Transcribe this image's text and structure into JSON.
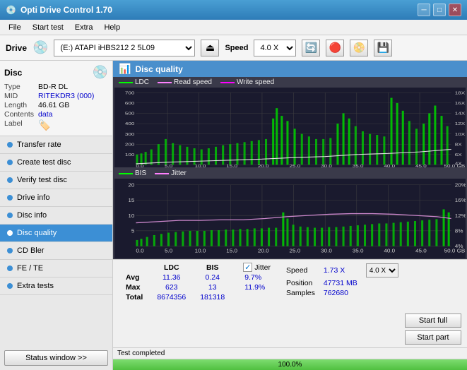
{
  "titleBar": {
    "title": "Opti Drive Control 1.70",
    "icon": "💿",
    "controls": [
      "─",
      "□",
      "✕"
    ]
  },
  "menuBar": {
    "items": [
      "File",
      "Start test",
      "Extra",
      "Help"
    ]
  },
  "driveBar": {
    "label": "Drive",
    "driveValue": "(E:)  ATAPI iHBS212  2 5L09",
    "speedLabel": "Speed",
    "speedValue": "4.0 X"
  },
  "disc": {
    "title": "Disc",
    "fields": [
      {
        "label": "Type",
        "value": "BD-R DL",
        "color": "black"
      },
      {
        "label": "MID",
        "value": "RITEKDR3 (000)",
        "color": "blue"
      },
      {
        "label": "Length",
        "value": "46.61 GB",
        "color": "black"
      },
      {
        "label": "Contents",
        "value": "data",
        "color": "blue"
      },
      {
        "label": "Label",
        "value": "",
        "color": "blue"
      }
    ]
  },
  "navItems": [
    {
      "label": "Transfer rate",
      "active": false
    },
    {
      "label": "Create test disc",
      "active": false
    },
    {
      "label": "Verify test disc",
      "active": false
    },
    {
      "label": "Drive info",
      "active": false
    },
    {
      "label": "Disc info",
      "active": false
    },
    {
      "label": "Disc quality",
      "active": true
    },
    {
      "label": "CD Bler",
      "active": false
    },
    {
      "label": "FE / TE",
      "active": false
    },
    {
      "label": "Extra tests",
      "active": false
    }
  ],
  "statusWindowBtn": "Status window >>",
  "statusText": "Test completed",
  "progressValue": "100.0%",
  "chartTitle": "Disc quality",
  "legend": {
    "ldc": {
      "label": "LDC",
      "color": "#00ff00"
    },
    "readSpeed": {
      "label": "Read speed",
      "color": "#ff80ff"
    },
    "writeSpeed": {
      "label": "Write speed",
      "color": "#ff00ff"
    }
  },
  "legend2": {
    "bis": {
      "label": "BIS",
      "color": "#00ff00"
    },
    "jitter": {
      "label": "Jitter",
      "color": "#ff80ff"
    }
  },
  "stats": {
    "columns": [
      "LDC",
      "BIS"
    ],
    "rows": [
      {
        "label": "Avg",
        "ldc": "11.36",
        "bis": "0.24"
      },
      {
        "label": "Max",
        "ldc": "623",
        "bis": "13"
      },
      {
        "label": "Total",
        "ldc": "8674356",
        "bis": "181318"
      }
    ],
    "jitter": {
      "checked": true,
      "label": "Jitter",
      "values": {
        "avg": "9.7%",
        "max": "11.9%",
        "total": ""
      }
    },
    "speed": {
      "speedLabel": "Speed",
      "speedValue": "1.73 X",
      "speedSelect": "4.0 X",
      "positionLabel": "Position",
      "positionValue": "47731 MB",
      "samplesLabel": "Samples",
      "samplesValue": "762680"
    }
  },
  "buttons": {
    "startFull": "Start full",
    "startPart": "Start part"
  }
}
